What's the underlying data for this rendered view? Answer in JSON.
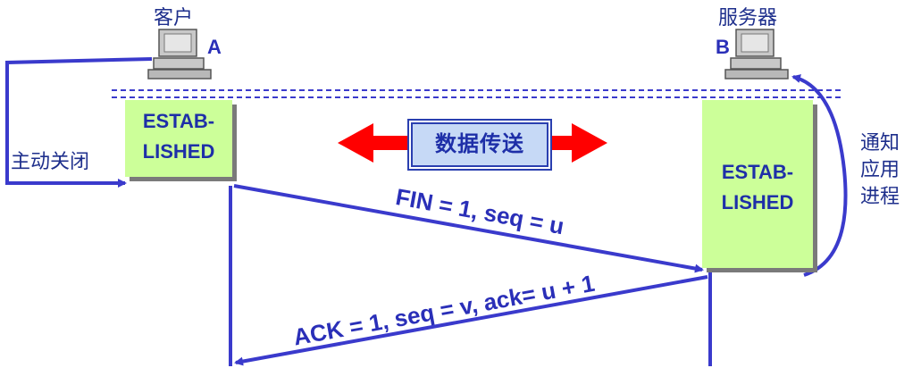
{
  "client": {
    "name": "客户",
    "letter": "A",
    "action_label": "主动关闭"
  },
  "server": {
    "name": "服务器",
    "letter": "B",
    "notify_label_lines": [
      "通知",
      "应用",
      "进程"
    ]
  },
  "state_a": {
    "lines": [
      "ESTAB-",
      "LISHED"
    ]
  },
  "state_b": {
    "lines": [
      "ESTAB-",
      "LISHED"
    ]
  },
  "data_transfer_label": "数据传送",
  "messages": {
    "fin": "FIN = 1, seq = u",
    "ack": "ACK = 1, seq = v, ack= u + 1"
  },
  "colors": {
    "line": "#3a3acc",
    "state_fill": "#ccff99",
    "data_arrow": "#ff0000",
    "data_box_fill": "#c6d9f6"
  }
}
